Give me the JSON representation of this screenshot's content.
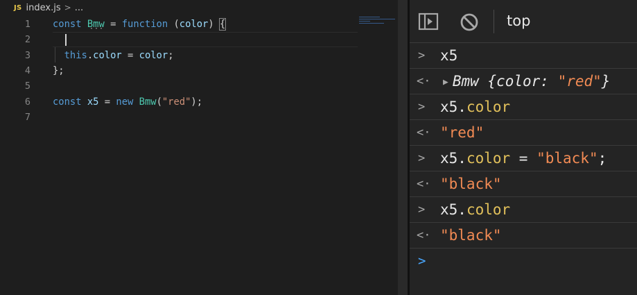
{
  "editor": {
    "breadcrumb": {
      "badge": "JS",
      "file": "index.js",
      "sep": ">",
      "more": "..."
    },
    "line_numbers": [
      "1",
      "2",
      "3",
      "4",
      "5",
      "6",
      "7"
    ],
    "lines": [
      {
        "t1": "const",
        "t2": " ",
        "t3": "Bmw",
        "t4": " = ",
        "t5": "function",
        "t6": " (",
        "t7": "color",
        "t8": ") ",
        "t9": "{"
      },
      {
        "t1": ""
      },
      {
        "t1": "  ",
        "t2": "this",
        "t3": ".",
        "t4": "color",
        "t5": " = ",
        "t6": "color",
        "t7": ";"
      },
      {
        "t1": "};"
      },
      {
        "t1": ""
      },
      {
        "t1": "const",
        "t2": " ",
        "t3": "x5",
        "t4": " = ",
        "t5": "new",
        "t6": " ",
        "t7": "Bmw",
        "t8": "(",
        "t9": "\"red\"",
        "t10": ");"
      },
      {
        "t1": ""
      }
    ],
    "lens_dots": "···"
  },
  "console": {
    "context": "top",
    "entries": [
      {
        "kind": "input",
        "icon": ">",
        "parts": [
          "x5"
        ]
      },
      {
        "kind": "output",
        "icon": "<·",
        "expand": "▶",
        "obj_name": "Bmw",
        "obj_open": " {color: ",
        "obj_val": "\"red\"",
        "obj_close": "}"
      },
      {
        "kind": "input",
        "icon": ">",
        "parts": [
          "x5.",
          "color"
        ]
      },
      {
        "kind": "output",
        "icon": "<·",
        "value": "\"red\""
      },
      {
        "kind": "input",
        "icon": ">",
        "parts": [
          "x5.",
          "color",
          " = ",
          "\"black\"",
          ";"
        ]
      },
      {
        "kind": "output",
        "icon": "<·",
        "value": "\"black\""
      },
      {
        "kind": "input",
        "icon": ">",
        "parts": [
          "x5.",
          "color"
        ]
      },
      {
        "kind": "output",
        "icon": "<·",
        "value": "\"black\""
      }
    ],
    "active_prompt": ">"
  },
  "colors": {
    "keyword": "#569cd6",
    "class": "#4ec9b0",
    "string": "#ce9178",
    "console_prop": "#e2c15b",
    "console_string": "#f28b54",
    "prompt": "#4aa8ff"
  }
}
